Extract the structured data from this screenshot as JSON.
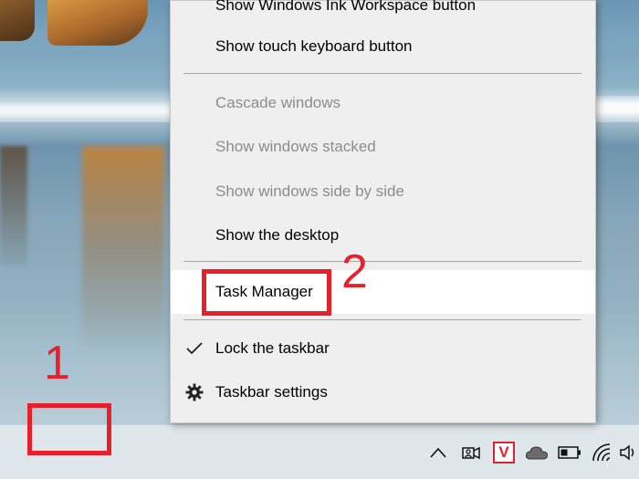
{
  "context_menu": {
    "items": [
      {
        "id": "ink-workspace",
        "label": "Show Windows Ink Workspace button",
        "state": "enabled"
      },
      {
        "id": "touch-keyboard",
        "label": "Show touch keyboard button",
        "state": "enabled"
      },
      {
        "id": "cascade",
        "label": "Cascade windows",
        "state": "disabled"
      },
      {
        "id": "stacked",
        "label": "Show windows stacked",
        "state": "disabled"
      },
      {
        "id": "side-by-side",
        "label": "Show windows side by side",
        "state": "disabled"
      },
      {
        "id": "show-desktop",
        "label": "Show the desktop",
        "state": "enabled"
      },
      {
        "id": "task-manager",
        "label": "Task Manager",
        "state": "highlighted"
      },
      {
        "id": "lock-taskbar",
        "label": "Lock the taskbar",
        "state": "checked",
        "lead_icon": "checkmark-icon"
      },
      {
        "id": "taskbar-settings",
        "label": "Taskbar settings",
        "state": "enabled",
        "lead_icon": "gear-icon"
      }
    ]
  },
  "system_tray": {
    "icons": [
      "chevron-up-icon",
      "meet-now-icon",
      "antivirus-v-icon",
      "cloud-icon",
      "battery-icon",
      "wifi-icon",
      "speaker-icon"
    ],
    "antivirus_letter": "V"
  },
  "annotations": {
    "step_1": "1",
    "step_2": "2",
    "color": "#e8202b"
  },
  "colors": {
    "menu_background": "#efefef",
    "highlight_background": "#ffffff",
    "disabled_text": "#8c8c8c",
    "taskbar": "#dfe6ec"
  }
}
